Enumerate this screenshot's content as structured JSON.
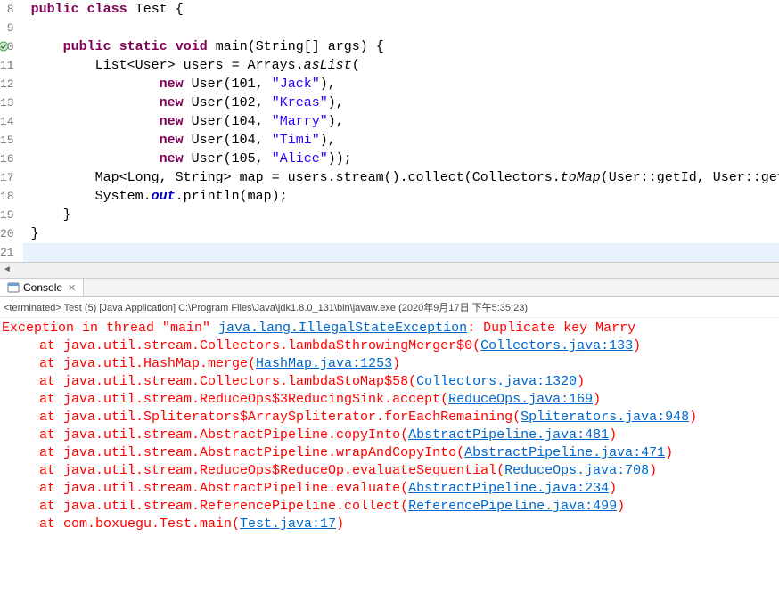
{
  "editor": {
    "lines": [
      {
        "n": 8,
        "marker": false
      },
      {
        "n": 9,
        "marker": false
      },
      {
        "n": 10,
        "marker": true
      },
      {
        "n": 11,
        "marker": false
      },
      {
        "n": 12,
        "marker": false
      },
      {
        "n": 13,
        "marker": false
      },
      {
        "n": 14,
        "marker": false
      },
      {
        "n": 15,
        "marker": false
      },
      {
        "n": 16,
        "marker": false
      },
      {
        "n": 17,
        "marker": false
      },
      {
        "n": 18,
        "marker": false
      },
      {
        "n": 19,
        "marker": false
      },
      {
        "n": 20,
        "marker": false
      },
      {
        "n": 21,
        "marker": false
      }
    ],
    "tok": {
      "public": "public",
      "class": "class",
      "Test": "Test",
      "lbrace": "{",
      "rbrace": "}",
      "static": "static",
      "void": "void",
      "main": "main",
      "mainArgs": "(String[] args) {",
      "List": "List<User> users = Arrays.",
      "asList": "asList",
      "lparen": "(",
      "new": "new",
      "UserOpen": " User(",
      "u1id": "101",
      "u1name": "\"Jack\"",
      "u2id": "102",
      "u2name": "\"Kreas\"",
      "u3id": "104",
      "u3name": "\"Marry\"",
      "u4id": "104",
      "u4name": "\"Timi\"",
      "u5id": "105",
      "u5name": "\"Alice\"",
      "commaClose": "),",
      "closeParen2": "));",
      "mapLine1": "Map<Long, String> map = users.stream().collect(Collectors.",
      "toMap": "toMap",
      "mapLine2": "(User::getId, User::getName));",
      "sysout1": "System.",
      "out": "out",
      "sysout2": ".println(map);",
      "comma": ", "
    }
  },
  "console": {
    "tabLabel": "Console",
    "infoLine": "<terminated> Test (5) [Java Application] C:\\Program Files\\Java\\jdk1.8.0_131\\bin\\javaw.exe (2020年9月17日 下午5:35:23)",
    "exceptionPrefix": "Exception in thread \"main\" ",
    "exceptionClass": "java.lang.IllegalStateException",
    "exceptionMsg": ": Duplicate key Marry",
    "frames": [
      {
        "pre": "at java.util.stream.Collectors.lambda$throwingMerger$0(",
        "link": "Collectors.java:133",
        "post": ")"
      },
      {
        "pre": "at java.util.HashMap.merge(",
        "link": "HashMap.java:1253",
        "post": ")"
      },
      {
        "pre": "at java.util.stream.Collectors.lambda$toMap$58(",
        "link": "Collectors.java:1320",
        "post": ")"
      },
      {
        "pre": "at java.util.stream.ReduceOps$3ReducingSink.accept(",
        "link": "ReduceOps.java:169",
        "post": ")"
      },
      {
        "pre": "at java.util.Spliterators$ArraySpliterator.forEachRemaining(",
        "link": "Spliterators.java:948",
        "post": ")"
      },
      {
        "pre": "at java.util.stream.AbstractPipeline.copyInto(",
        "link": "AbstractPipeline.java:481",
        "post": ")"
      },
      {
        "pre": "at java.util.stream.AbstractPipeline.wrapAndCopyInto(",
        "link": "AbstractPipeline.java:471",
        "post": ")"
      },
      {
        "pre": "at java.util.stream.ReduceOps$ReduceOp.evaluateSequential(",
        "link": "ReduceOps.java:708",
        "post": ")"
      },
      {
        "pre": "at java.util.stream.AbstractPipeline.evaluate(",
        "link": "AbstractPipeline.java:234",
        "post": ")"
      },
      {
        "pre": "at java.util.stream.ReferencePipeline.collect(",
        "link": "ReferencePipeline.java:499",
        "post": ")"
      },
      {
        "pre": "at com.boxuegu.Test.main(",
        "link": "Test.java:17",
        "post": ")"
      }
    ]
  }
}
